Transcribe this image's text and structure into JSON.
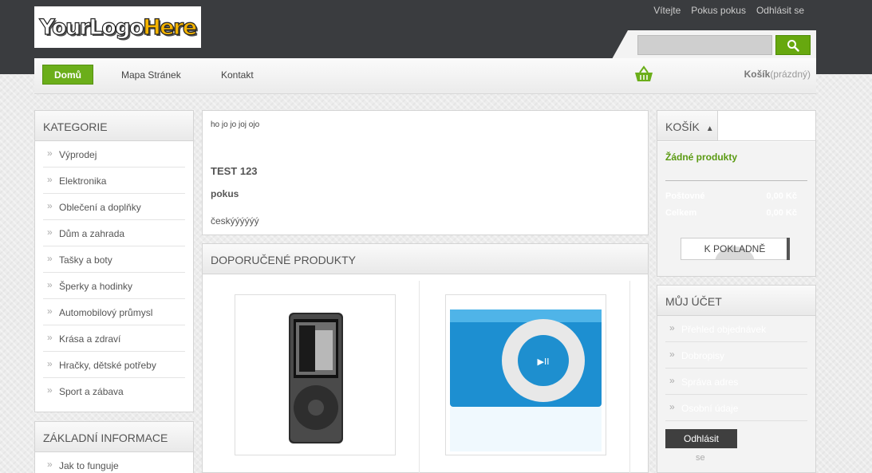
{
  "header": {
    "logo": {
      "part1": "YourLogo",
      "part2": "Here"
    },
    "top_links": [
      "Vítejte",
      "Pokus pokus",
      "Odhlásit se"
    ],
    "search": {
      "placeholder": "",
      "button_icon": "search-icon"
    }
  },
  "nav": {
    "items": [
      "Domů",
      "Mapa Stránek",
      "Kontakt"
    ],
    "cart_label": "Košík",
    "cart_status": "(prázdný)",
    "cart_icon": "basket-icon",
    "accent": "#6bae1a"
  },
  "categories": {
    "title": "KATEGORIE",
    "items": [
      "Výprodej",
      "Elektronika",
      "Oblečení a doplňky",
      "Dům a zahrada",
      "Tašky a boty",
      "Šperky a hodinky",
      "Automobilový průmysl",
      "Krása a zdraví",
      "Hračky, dětské potřeby",
      "Sport a zábava"
    ]
  },
  "info": {
    "title": "ZÁKLADNÍ INFORMACE",
    "items": [
      "Jak to funguje"
    ]
  },
  "content": {
    "line1": "ho jo jo joj ojo",
    "heading": "TEST 123",
    "bold": "pokus",
    "text": "českýýýýýý"
  },
  "featured": {
    "title": "DOPORUČENÉ PRODUKTY",
    "products": [
      {
        "image": "ipod-nano-black"
      },
      {
        "image": "ipod-shuffle-blue"
      }
    ]
  },
  "cart": {
    "title": "KOŠÍK",
    "empty": "Žádné produkty",
    "rows": [
      {
        "label": "Poštovné",
        "value": "0,00 Kč"
      },
      {
        "label": "Celkem",
        "value": "0,00 Kč"
      }
    ],
    "checkout": "K POKLADNĚ"
  },
  "account": {
    "title": "MŮJ ÚČET",
    "items": [
      "Přehled objednávek",
      "Dobropisy",
      "Správa adres",
      "Osobní údaje"
    ],
    "logout": "Odhlásit",
    "se": "se"
  }
}
